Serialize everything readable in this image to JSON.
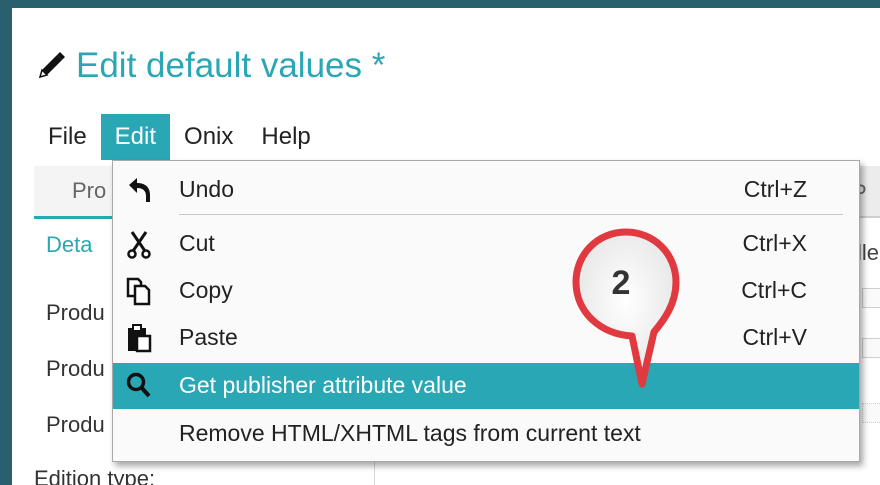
{
  "window": {
    "title": "Edit default values *"
  },
  "menubar": {
    "items": [
      "File",
      "Edit",
      "Onix",
      "Help"
    ],
    "active": "Edit"
  },
  "background": {
    "tab_partial": "Pro",
    "tab_right_partial": "P",
    "subtab_partial": "Deta",
    "subtab_right_partial": "lle",
    "field_labels": [
      "Produ",
      "Produ",
      "Produ"
    ],
    "edition_label": "Edition type:"
  },
  "edit_menu": {
    "items": [
      {
        "icon": "undo-icon",
        "label": "Undo",
        "shortcut": "Ctrl+Z"
      },
      {
        "icon": "cut-icon",
        "label": "Cut",
        "shortcut": "Ctrl+X"
      },
      {
        "icon": "copy-icon",
        "label": "Copy",
        "shortcut": "Ctrl+C"
      },
      {
        "icon": "paste-icon",
        "label": "Paste",
        "shortcut": "Ctrl+V"
      },
      {
        "icon": "search-icon",
        "label": "Get publisher attribute value",
        "shortcut": ""
      },
      {
        "icon": "",
        "label": "Remove HTML/XHTML tags from current text",
        "shortcut": ""
      }
    ],
    "highlighted_index": 4
  },
  "callout": {
    "number": "2",
    "color": "#e0393f"
  },
  "colors": {
    "accent": "#2aa7b5",
    "frame": "#2a5f6e"
  }
}
